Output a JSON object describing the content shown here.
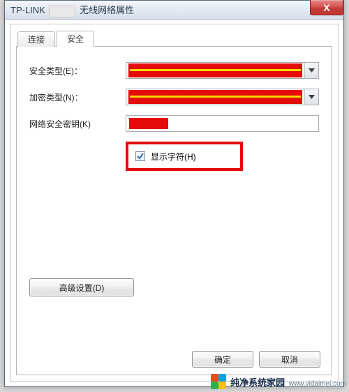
{
  "window": {
    "title_prefix": "TP-LINK",
    "title_suffix": "无线网络属性",
    "close_glyph": "X"
  },
  "tabs": {
    "connect": "连接",
    "security": "安全"
  },
  "form": {
    "security_type_label": "安全类型(E)：",
    "encryption_type_label": "加密类型(N)：",
    "network_key_label": "网络安全密钥(K)",
    "show_chars_label": "显示字符(H)"
  },
  "buttons": {
    "advanced": "高级设置(D)",
    "ok": "确定",
    "cancel": "取消"
  },
  "watermark": {
    "brand": "纯净系统家园",
    "url": "www.yidaimei.com"
  }
}
